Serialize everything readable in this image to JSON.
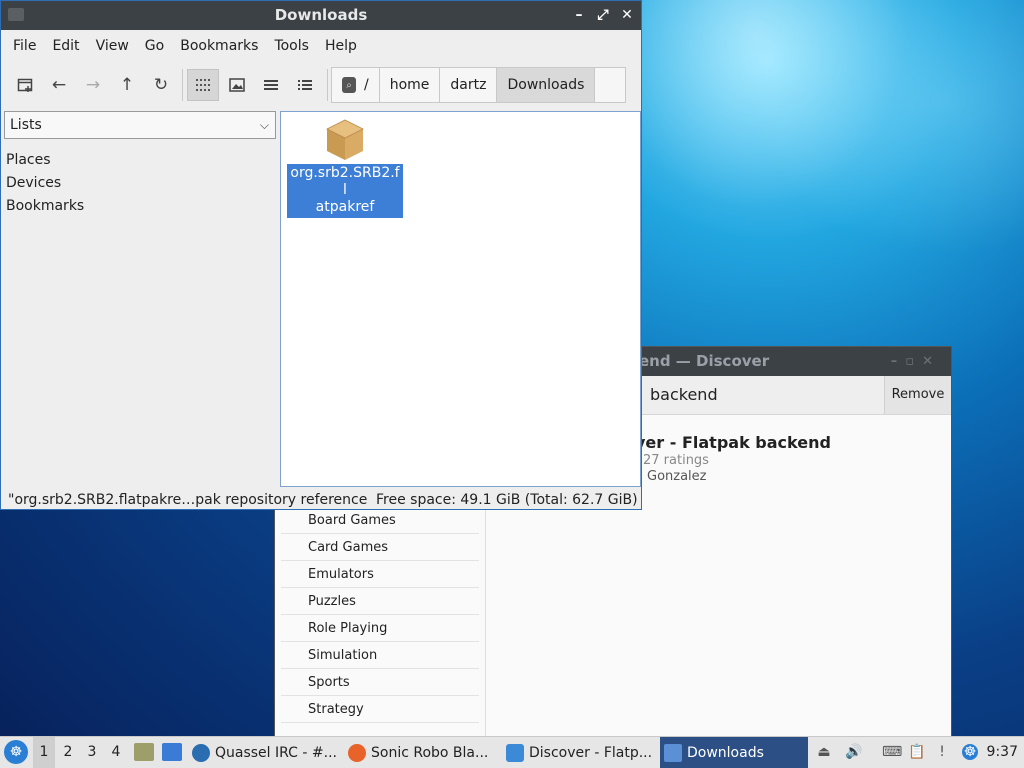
{
  "discover": {
    "title": "Discover — Discover",
    "title_visible": "end — Discover",
    "search_text": "backend",
    "remove_label": "Remove",
    "app_title": "ver - Flatpak backend",
    "app_ratings": "27 ratings",
    "app_author": "Gonzalez",
    "categories": [
      "Board Games",
      "Card Games",
      "Emulators",
      "Puzzles",
      "Role Playing",
      "Simulation",
      "Sports",
      "Strategy"
    ]
  },
  "file_manager": {
    "title": "Downloads",
    "menus": [
      "File",
      "Edit",
      "View",
      "Go",
      "Bookmarks",
      "Tools",
      "Help"
    ],
    "path": {
      "root": "/",
      "parts": [
        "home",
        "dartz",
        "Downloads"
      ]
    },
    "sidebar_mode": "Lists",
    "sidebar_items": [
      "Places",
      "Devices",
      "Bookmarks"
    ],
    "files": [
      {
        "name": "org.srb2.SRB2.flatpakref",
        "icon": "package-icon",
        "selected": true,
        "label_line1": "org.srb2.SRB2.fl",
        "label_line2": "atpakref"
      }
    ],
    "status_left": "\"org.srb2.SRB2.flatpakre…pak repository reference",
    "status_right": "Free space: 49.1 GiB (Total: 62.7 GiB)"
  },
  "taskbar": {
    "workspaces": [
      "1",
      "2",
      "3",
      "4"
    ],
    "active_workspace": "1",
    "tasks": [
      {
        "label": "Quassel IRC - #...",
        "icon": "quassel-icon",
        "active": false
      },
      {
        "label": "Sonic Robo Bla...",
        "icon": "firefox-icon",
        "active": false
      },
      {
        "label": "Discover - Flatp...",
        "icon": "discover-icon",
        "active": false
      },
      {
        "label": "Downloads",
        "icon": "folder-icon",
        "active": true
      }
    ],
    "clock": "9:37"
  }
}
